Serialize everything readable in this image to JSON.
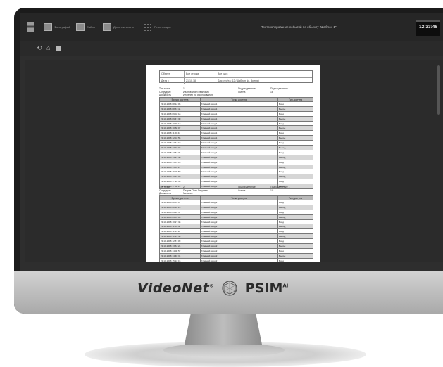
{
  "toolbar": {
    "buttons": [
      {
        "icon": "report-icon",
        "label": "Фотографий"
      },
      {
        "icon": "print-icon",
        "label": "Сайты"
      },
      {
        "icon": "settings-icon",
        "label": "Дополнительно"
      },
      {
        "icon": "grid-icon",
        "label": "Регистрации"
      }
    ],
    "window_title": "Протоколирование событий по объекту \"Шаблон 1\"",
    "clock": "12:33:46"
  },
  "subbar": {
    "icons": [
      "rotate-left-icon",
      "home-icon",
      "bookmark-icon"
    ]
  },
  "report": {
    "header_rows": [
      [
        "Объект",
        "Все строки",
        "Все сист."
      ],
      [
        "Дата с",
        "21.10.18",
        "Для отчёта: 12 (Шаблон №. Время)"
      ]
    ],
    "section1": {
      "info": {
        "line1_left": "Тип точки",
        "line1_mid": "1",
        "line1_r1": "Подразделение",
        "line1_r2": "Подразделение 1",
        "line2_left": "Сотрудник",
        "line2_mid": "Иванов Иван Иванович",
        "line2_r1": "Смена",
        "line2_r2": "1В",
        "line3_left": "Должность",
        "line3_mid": "Инженер по оборудованию"
      },
      "columns": [
        "Время доступа",
        "Точка доступа",
        "Тип доступа"
      ],
      "rows": [
        [
          "21.10.2018 08:12:05",
          "Главный вход 1",
          "Вход"
        ],
        [
          "21.10.2018 08:31:44",
          "Главный вход 1",
          "Выход"
        ],
        [
          "21.10.2018 09:02:18",
          "Главный вход 1",
          "Вход"
        ],
        [
          "21.10.2018 09:47:30",
          "Главный вход 1",
          "Выход"
        ],
        [
          "21.10.2018 10:15:12",
          "Главный вход 1",
          "Вход"
        ],
        [
          "21.10.2018 10:58:07",
          "Главный вход 1",
          "Выход"
        ],
        [
          "21.10.2018 11:20:41",
          "Главный вход 1",
          "Вход"
        ],
        [
          "21.10.2018 12:03:55",
          "Главный вход 1",
          "Выход"
        ],
        [
          "21.10.2018 12:44:19",
          "Главный вход 1",
          "Вход"
        ],
        [
          "21.10.2018 13:10:02",
          "Главный вход 1",
          "Выход"
        ],
        [
          "21.10.2018 13:52:36",
          "Главный вход 1",
          "Вход"
        ],
        [
          "21.10.2018 14:25:48",
          "Главный вход 1",
          "Выход"
        ],
        [
          "21.10.2018 15:01:13",
          "Главный вход 1",
          "Вход"
        ],
        [
          "21.10.2018 15:39:27",
          "Главный вход 1",
          "Выход"
        ],
        [
          "21.10.2018 16:08:50",
          "Главный вход 1",
          "Вход"
        ],
        [
          "21.10.2018 16:44:06",
          "Главный вход 1",
          "Выход"
        ],
        [
          "21.10.2018 17:20:33",
          "Главный вход 1",
          "Вход"
        ],
        [
          "21.10.2018 17:58:21",
          "Главный вход 1",
          "Выход"
        ]
      ]
    },
    "section2": {
      "info": {
        "line1_left": "Тип точки",
        "line1_mid": "2",
        "line1_r1": "Подразделение",
        "line1_r2": "Подразделение 1",
        "line2_left": "Сотрудник",
        "line2_mid": "Петров Петр Петрович",
        "line2_r1": "Смена",
        "line2_r2": "1С",
        "line3_left": "Должность",
        "line3_mid": "Механик"
      },
      "columns": [
        "Время доступа",
        "Точка доступа",
        "Тип доступа"
      ],
      "rows": [
        [
          "21.10.2018 08:05:11",
          "Главный вход 2",
          "Вход"
        ],
        [
          "21.10.2018 08:40:29",
          "Главный вход 2",
          "Выход"
        ],
        [
          "21.10.2018 09:12:47",
          "Главный вход 2",
          "Вход"
        ],
        [
          "21.10.2018 09:55:03",
          "Главный вход 2",
          "Выход"
        ],
        [
          "21.10.2018 10:27:38",
          "Главный вход 2",
          "Вход"
        ],
        [
          "21.10.2018 11:06:52",
          "Главный вход 2",
          "Выход"
        ],
        [
          "21.10.2018 11:44:16",
          "Главный вход 2",
          "Вход"
        ],
        [
          "21.10.2018 12:19:40",
          "Главный вход 2",
          "Выход"
        ],
        [
          "21.10.2018 12:57:09",
          "Главный вход 2",
          "Вход"
        ],
        [
          "21.10.2018 13:33:24",
          "Главный вход 2",
          "Выход"
        ],
        [
          "21.10.2018 14:08:57",
          "Главный вход 2",
          "Вход"
        ],
        [
          "21.10.2018 14:46:31",
          "Главный вход 2",
          "Выход"
        ],
        [
          "21.10.2018 15:22:15",
          "Главный вход 2",
          "Вход"
        ],
        [
          "21.10.2018 15:59:42",
          "Главный вход 2",
          "Выход"
        ]
      ]
    }
  },
  "branding": {
    "videonet": "VideoNet",
    "videonet_mark": "®",
    "psim": "PSIM",
    "psim_sup": "AI"
  }
}
